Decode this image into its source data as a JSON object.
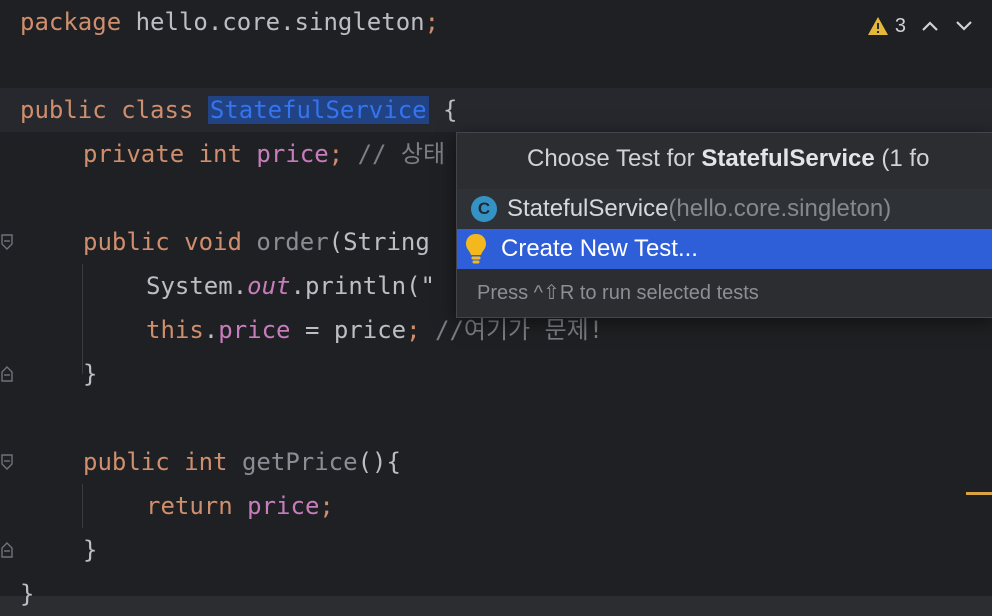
{
  "editor": {
    "lines": [
      {
        "parts": [
          "package",
          " hello.core.singleton",
          ";"
        ]
      },
      {
        "parts": [
          "public",
          " ",
          "class",
          " ",
          "StatefulService",
          " {"
        ]
      },
      {
        "parts": [
          "private",
          " ",
          "int",
          " ",
          "price",
          ";",
          " // 상태"
        ]
      },
      {
        "parts": [
          "public",
          " ",
          "void",
          " ",
          "order",
          "(String"
        ]
      },
      {
        "parts": [
          "System.",
          "out",
          ".println(\""
        ]
      },
      {
        "parts": [
          "this",
          ".",
          "price",
          " = price",
          ";",
          " //여기가 문제!"
        ]
      },
      {
        "parts": [
          "}"
        ]
      },
      {
        "parts": [
          "public",
          " ",
          "int",
          " ",
          "getPrice",
          "(){"
        ]
      },
      {
        "parts": [
          "return",
          " ",
          "price",
          ";"
        ]
      },
      {
        "parts": [
          "}"
        ]
      },
      {
        "parts": [
          "}"
        ]
      }
    ]
  },
  "inspection": {
    "warning_count": "3",
    "warning_color": "#e4b83a"
  },
  "popup": {
    "title_prefix": "Choose Test for ",
    "title_class": "StatefulService",
    "title_suffix": " (1 fo",
    "items": [
      {
        "icon": "class-icon",
        "icon_letter": "C",
        "label": "StatefulService",
        "detail": " (hello.core.singleton)"
      },
      {
        "icon": "lightbulb-icon",
        "label": "Create New Test..."
      }
    ],
    "footer": "Press ^⇧R to run selected tests"
  },
  "colors": {
    "keyword": "#cf8e6d",
    "field": "#c77dbb",
    "selection": "#2e5fd8"
  }
}
